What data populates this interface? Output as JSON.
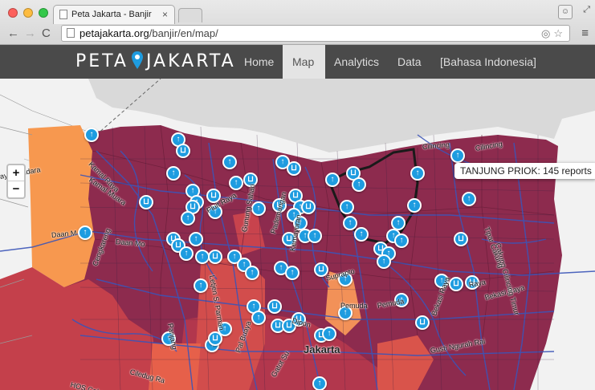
{
  "browser": {
    "tab_title": "Peta Jakarta - Banjir",
    "tab_close": "×",
    "url_host": "petajakarta.org",
    "url_path": "/banjir/en/map/",
    "back_icon": "arrow-left-icon",
    "forward_icon": "arrow-right-icon",
    "reload_icon": "reload-icon",
    "menu_icon": "hamburger-menu-icon"
  },
  "site": {
    "brand_left": "PETA",
    "brand_right": "JAKARTA",
    "nav": [
      {
        "label": "Home",
        "active": false
      },
      {
        "label": "Map",
        "active": true
      },
      {
        "label": "Analytics",
        "active": false
      },
      {
        "label": "Data",
        "active": false
      },
      {
        "label": "[Bahasa Indonesia]",
        "active": false
      }
    ]
  },
  "map": {
    "zoom_in": "+",
    "zoom_out": "−",
    "info": "TANJUNG PRIOK: 145 reports",
    "colors": {
      "sea": "#d9d9d9",
      "land": "#f2f2f2",
      "district_dark": "#8d2b4e",
      "district_mid": "#c4404b",
      "district_hot": "#e6604a",
      "district_orange": "#f7984f",
      "rivers": "#3b55b8",
      "marker": "#1e9ce0"
    },
    "marker_icons": [
      "report-arrow-icon",
      "report-tray-icon"
    ],
    "labels": [
      "aya Bandara",
      "Kamal Raya",
      "Kamal Muara",
      "Daan M",
      "Daan Mo",
      "Cilincing",
      "Cilincing",
      "Pluit Raya",
      "Jakarta",
      "Cengkareng",
      "Pademangan",
      "Gunung Sahari",
      "Kemayoran",
      "Suprapto",
      "Pemuda",
      "Pemuda",
      "Bekasi Raya",
      "Raya",
      "Gusti Ngurah Rai",
      "Bekasi Raya",
      "Cakung Cilincing Timur",
      "Tipar Cakung",
      "Dipon",
      "Ciledug Ra",
      "HOS Cokroamino",
      "Letjen S. Parman",
      "Panjang",
      "Gatot Su",
      "Pal Buaya"
    ]
  }
}
